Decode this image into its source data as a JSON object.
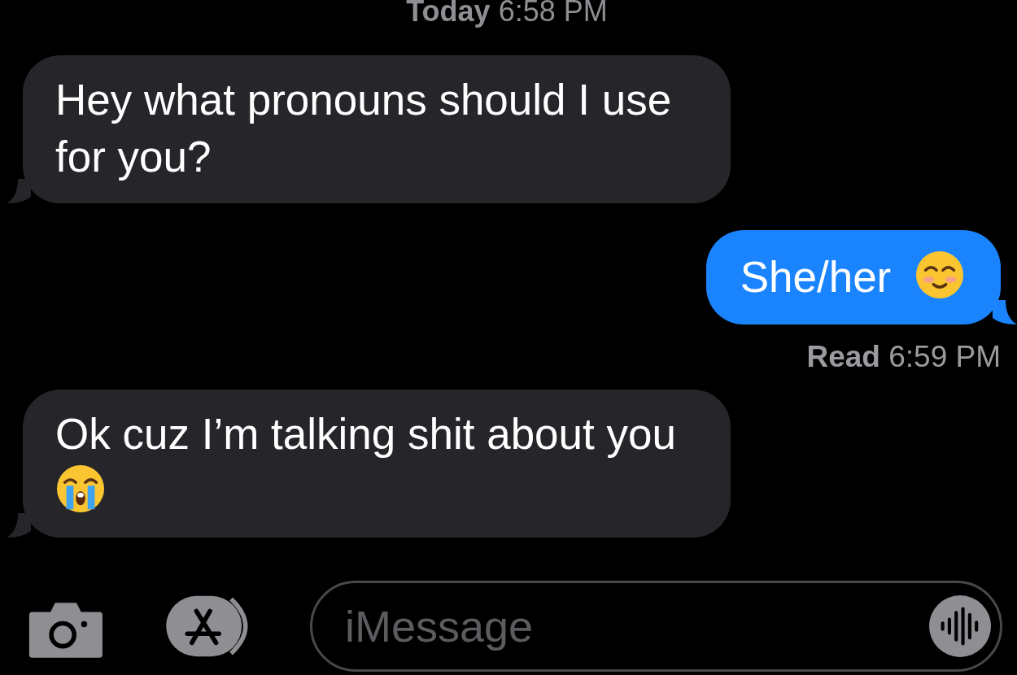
{
  "timestamp": "**Today** 6:58 PM",
  "messages": [
    {
      "kind": "incoming",
      "text": "Hey what pronouns should I use for you?"
    },
    {
      "kind": "outgoing",
      "text": "She/her",
      "emoji": {
        "kind": "smiling"
      }
    },
    {
      "kind": "status",
      "text": "**Read** 6:59 PM"
    },
    {
      "kind": "incoming",
      "text": "Ok cuz I’m talking shit about you",
      "emoji": {
        "kind": "crying"
      }
    }
  ],
  "input": {
    "placeholder": "iMessage"
  }
}
